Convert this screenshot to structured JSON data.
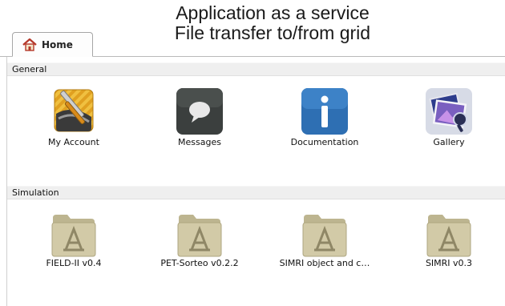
{
  "caption": {
    "line1": "Application as a service",
    "line2": "File transfer to/from grid"
  },
  "tabs": [
    {
      "label": "Home",
      "icon": "home-icon",
      "icon_color": "#b5382a",
      "selected": true
    }
  ],
  "sections": {
    "general": {
      "title": "General",
      "items": [
        {
          "label": "My Account",
          "icon": "account-tools-icon"
        },
        {
          "label": "Messages",
          "icon": "speech-bubble-icon"
        },
        {
          "label": "Documentation",
          "icon": "info-icon"
        },
        {
          "label": "Gallery",
          "icon": "gallery-icon"
        }
      ]
    },
    "simulation": {
      "title": "Simulation",
      "items": [
        {
          "label": "FIELD-II v0.4",
          "icon": "app-folder-icon"
        },
        {
          "label": "PET-Sorteo v0.2.2",
          "icon": "app-folder-icon"
        },
        {
          "label": "SIMRI object and c…",
          "icon": "app-folder-icon"
        },
        {
          "label": "SIMRI v0.3",
          "icon": "app-folder-icon"
        }
      ]
    }
  },
  "colors": {
    "info_blue": "#2e6fb3",
    "messages_dark": "#3b3f3e",
    "folder_tan": "#cfc7a4",
    "gallery_purple": "#8a79c9"
  }
}
